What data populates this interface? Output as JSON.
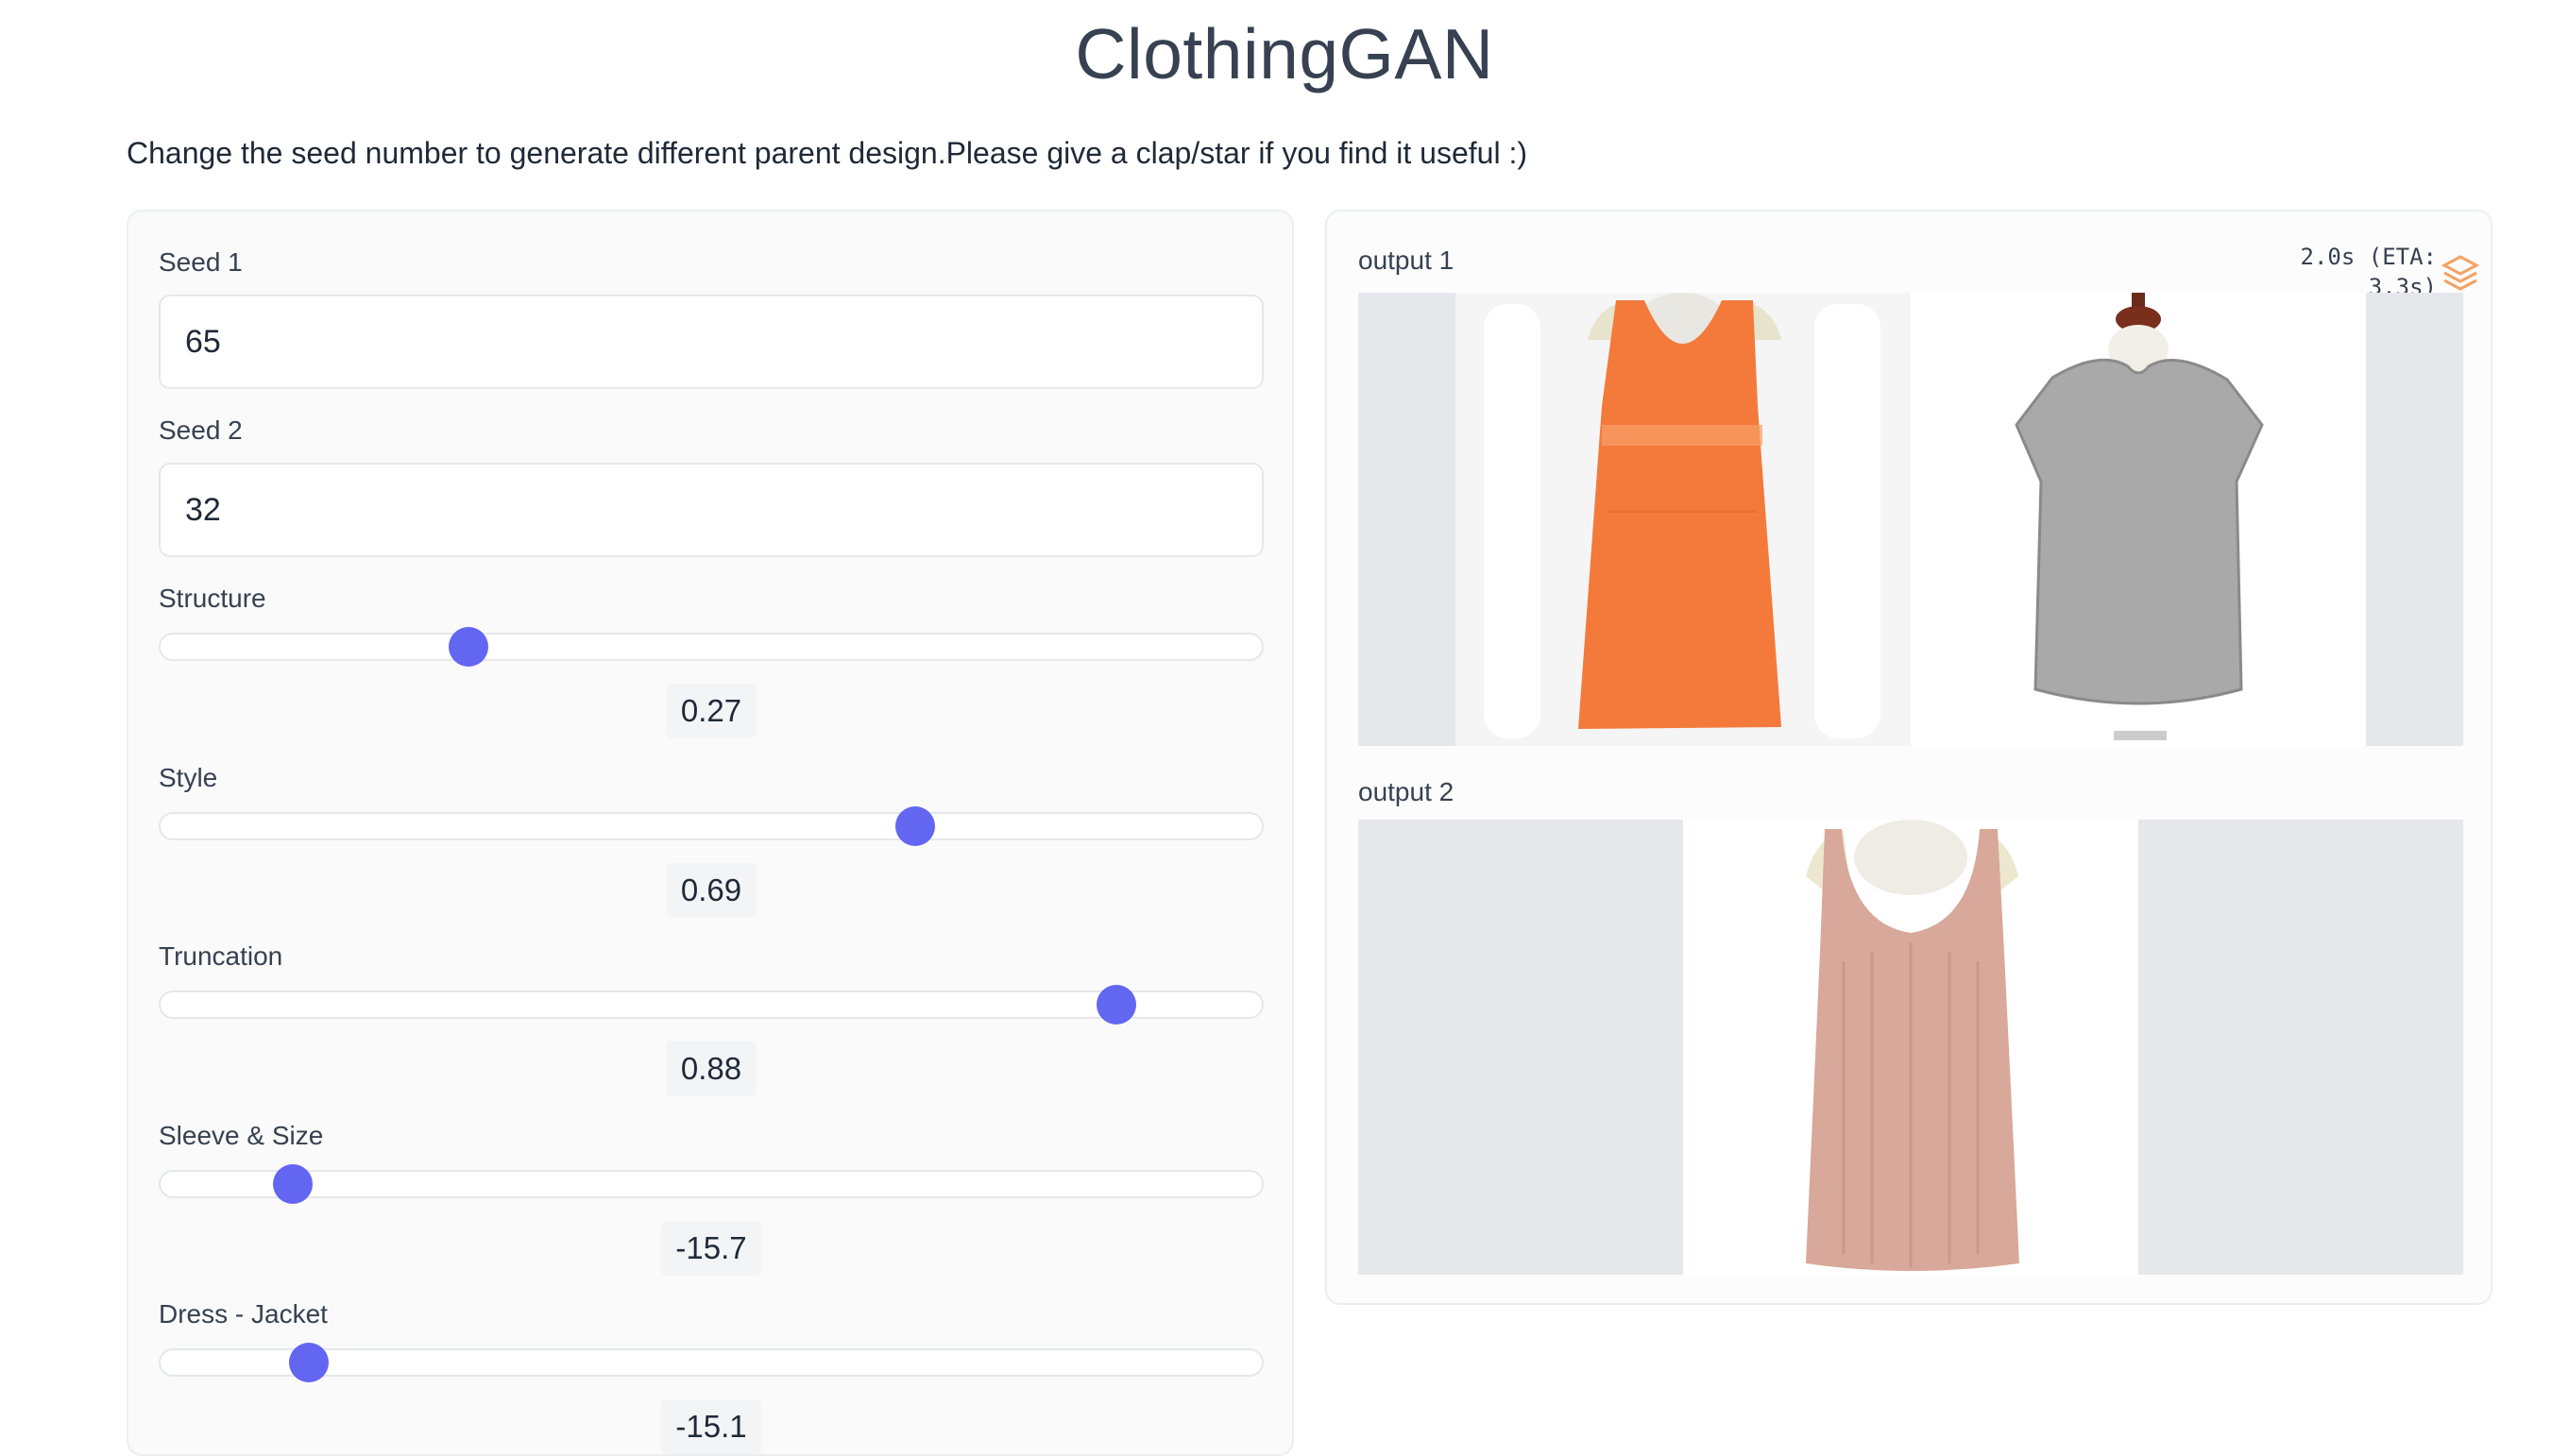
{
  "app": {
    "title": "ClothingGAN",
    "description": "Change the seed number to generate different parent design.Please give a clap/star if you find it useful :)"
  },
  "inputs": {
    "seed1": {
      "label": "Seed 1",
      "value": "65"
    },
    "seed2": {
      "label": "Seed 2",
      "value": "32"
    }
  },
  "sliders": [
    {
      "label": "Structure",
      "value": "0.27",
      "position": 0.28
    },
    {
      "label": "Style",
      "value": "0.69",
      "position": 0.685
    },
    {
      "label": "Truncation",
      "value": "0.88",
      "position": 0.868
    },
    {
      "label": "Sleeve & Size",
      "value": "-15.7",
      "position": 0.12
    },
    {
      "label": "Dress - Jacket",
      "value": "-15.1",
      "position": 0.135
    }
  ],
  "outputs": {
    "output1": {
      "label": "output 1"
    },
    "output2": {
      "label": "output 2"
    },
    "status": "2.0s (ETA: 3.3s)",
    "status_icon": "orange-loader-icon"
  },
  "colors": {
    "accent": "#6366f1",
    "panel_bg": "#fafafa",
    "image_bg": "#e5e7eb",
    "status_icon": "#f4a261"
  }
}
